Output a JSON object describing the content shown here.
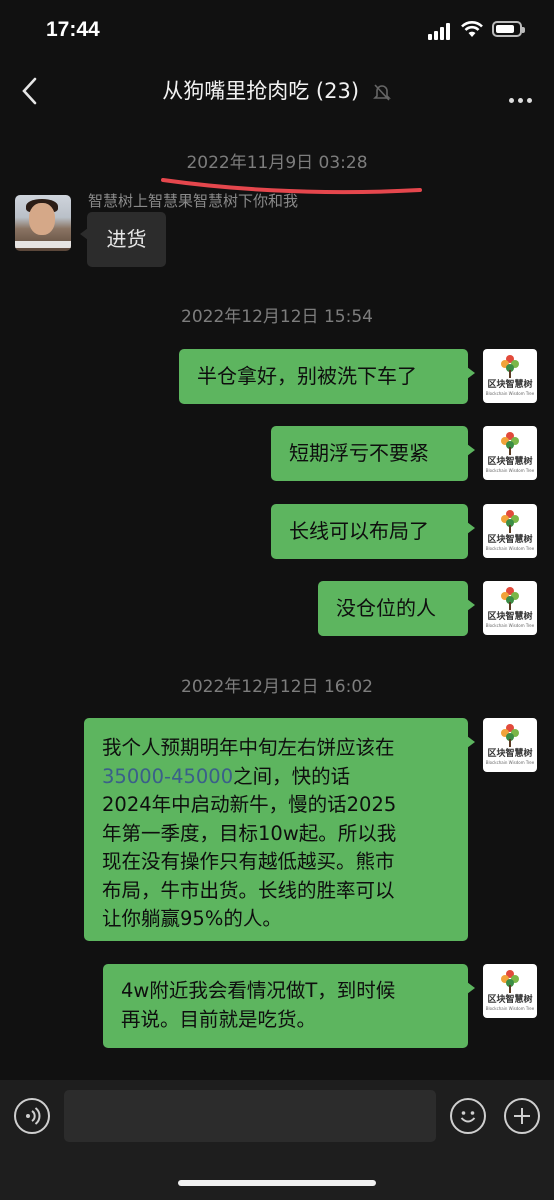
{
  "status": {
    "time": "17:44"
  },
  "header": {
    "title": "从狗嘴里抢肉吃 (23)"
  },
  "timestamps": [
    "2022年11月9日 03:28",
    "2022年12月12日 15:54",
    "2022年12月12日 16:02"
  ],
  "incoming": {
    "sender": "智慧树上智慧果智慧树下你和我",
    "text": "进货"
  },
  "brand_avatar": {
    "name": "区块智慧树",
    "en": "Blockchain Wisdom Tree"
  },
  "outgoing": [
    {
      "text": "半仓拿好，别被洗下车了"
    },
    {
      "text": "短期浮亏不要紧"
    },
    {
      "text": "长线可以布局了"
    },
    {
      "text": "没仓位的人"
    },
    {
      "line1_pre": "我个人预期明年中旬左右饼应该在",
      "line2_link": "35000-45000",
      "line2_post": "之间，快的话",
      "line3": "2024年中启动新牛，慢的话2025",
      "line4": "年第一季度，目标10w起。所以我",
      "line5": "现在没有操作只有越低越买。熊市",
      "line6": "布局，牛市出货。长线的胜率可以",
      "line7": "让你躺赢95%的人。"
    },
    {
      "line1": "4w附近我会看情况做T，到时候",
      "line2": "再说。目前就是吃货。"
    }
  ],
  "colors": {
    "bubble_out": "#5db55f",
    "bubble_in": "#2c2c2c",
    "background": "#111111",
    "link": "#3a5f8a"
  }
}
